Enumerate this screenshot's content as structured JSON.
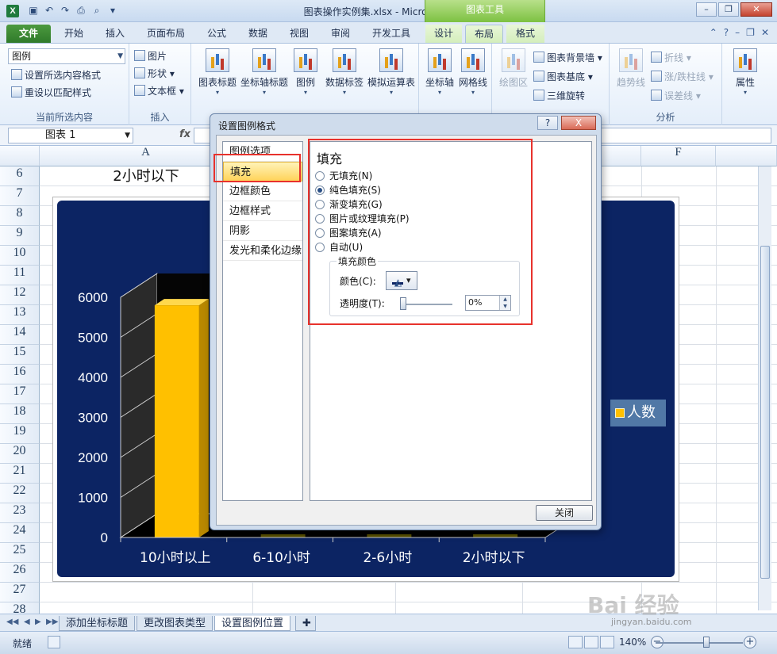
{
  "window": {
    "title": "图表操作实例集.xlsx - Microsoft Excel",
    "context_tools_label": "图表工具",
    "app_icon": "X"
  },
  "ribbon_tabs": [
    {
      "label": "文件"
    },
    {
      "label": "开始"
    },
    {
      "label": "插入"
    },
    {
      "label": "页面布局"
    },
    {
      "label": "公式"
    },
    {
      "label": "数据"
    },
    {
      "label": "视图"
    },
    {
      "label": "审阅"
    },
    {
      "label": "开发工具"
    },
    {
      "label": "设计"
    },
    {
      "label": "布局"
    },
    {
      "label": "格式"
    }
  ],
  "ribbon": {
    "current_selection": {
      "combo_value": "图例",
      "format_selection": "设置所选内容格式",
      "reset_style": "重设以匹配样式",
      "group_label": "当前所选内容"
    },
    "insert": {
      "picture": "图片",
      "shapes": "形状",
      "textbox": "文本框",
      "group_label": "插入"
    },
    "labels_buttons": [
      "图表标题",
      "坐标轴标题",
      "图例",
      "数据标签",
      "模拟运算表"
    ],
    "axes_buttons": [
      "坐标轴",
      "网格线"
    ],
    "background": {
      "plot_area": "绘图区",
      "chart_wall": "图表背景墙",
      "chart_floor": "图表基底",
      "rotation_3d": "三维旋转"
    },
    "analysis": {
      "trendline": "趋势线",
      "lines": "折线",
      "up_down_bars": "涨/跌柱线",
      "error_bars": "误差线",
      "group_label": "分析"
    },
    "properties": "属性"
  },
  "formula_bar": {
    "name_box": "图表 1",
    "fx": "fx"
  },
  "grid": {
    "columns": [
      "A",
      "F"
    ],
    "rows": [
      "6",
      "7",
      "8",
      "9",
      "10",
      "11",
      "12",
      "13",
      "14",
      "15",
      "16",
      "17",
      "18",
      "19",
      "20",
      "21",
      "22",
      "23",
      "24",
      "25",
      "26",
      "27",
      "28"
    ],
    "cell_a6": "2小时以下"
  },
  "chart_data": {
    "type": "bar",
    "categories": [
      "10小时以上",
      "6-10小时",
      "2-6小时",
      "2小时以下"
    ],
    "series": [
      {
        "name": "人数",
        "values": [
          5800,
          0,
          0,
          0
        ]
      }
    ],
    "y_ticks": [
      "0",
      "1000",
      "2000",
      "3000",
      "4000",
      "5000",
      "6000"
    ],
    "ylim": [
      0,
      6000
    ],
    "bar_color": "#ffc000",
    "background_color": "#0c2463",
    "legend_position": "right",
    "style": "3d-column"
  },
  "dialog": {
    "title": "设置图例格式",
    "help": "?",
    "close_x": "X",
    "nav_items": [
      "图例选项",
      "填充",
      "边框颜色",
      "边框样式",
      "阴影",
      "发光和柔化边缘"
    ],
    "selected_nav": "填充",
    "panel_heading": "填充",
    "fill_options": [
      "无填充(N)",
      "纯色填充(S)",
      "渐变填充(G)",
      "图片或纹理填充(P)",
      "图案填充(A)",
      "自动(U)"
    ],
    "selected_fill": "纯色填充(S)",
    "fill_color_group": "填充颜色",
    "color_label": "颜色(C):",
    "transparency_label": "透明度(T):",
    "transparency_value": "0%",
    "close_button": "关闭"
  },
  "sheet_tabs": [
    "添加坐标标题",
    "更改图表类型",
    "设置图例位置"
  ],
  "active_sheet": "设置图例位置",
  "status": {
    "ready": "就绪",
    "zoom": "140%"
  },
  "watermark": {
    "logo": "Bai 经验",
    "url": "jingyan.baidu.com"
  },
  "colors": {
    "highlight": "#e8322c",
    "ribbon_green": "#2f7a2a",
    "chart_bg": "#0c2463"
  }
}
